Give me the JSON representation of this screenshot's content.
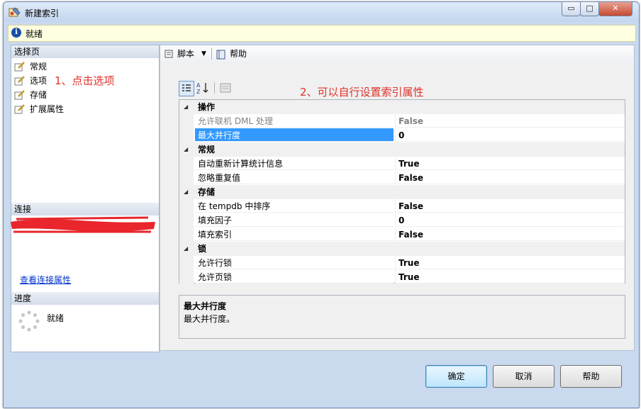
{
  "window": {
    "title": "新建索引",
    "controls": {
      "minimize": "▭",
      "maximize": "□",
      "close": "✕"
    }
  },
  "infobar": {
    "status": "就绪"
  },
  "left": {
    "select_page_header": "选择页",
    "pages": [
      {
        "label": "常规"
      },
      {
        "label": "选项"
      },
      {
        "label": "存储"
      },
      {
        "label": "扩展属性"
      }
    ],
    "connection_header": "连接",
    "view_connection_properties": "查看连接属性",
    "progress_header": "进度",
    "progress_status": "就绪"
  },
  "toolbar": {
    "script": "脚本",
    "help": "帮助"
  },
  "properties": {
    "categories": [
      {
        "name": "操作",
        "rows": [
          {
            "name": "允许联机 DML 处理",
            "value": "False"
          },
          {
            "name": "最大并行度",
            "value": "0"
          }
        ]
      },
      {
        "name": "常规",
        "rows": [
          {
            "name": "自动重新计算统计信息",
            "value": "True"
          },
          {
            "name": "忽略重复值",
            "value": "False"
          }
        ]
      },
      {
        "name": "存储",
        "rows": [
          {
            "name": "在 tempdb 中排序",
            "value": "False"
          },
          {
            "name": "填充因子",
            "value": "0"
          },
          {
            "name": "填充索引",
            "value": "False"
          }
        ]
      },
      {
        "name": "锁",
        "rows": [
          {
            "name": "允许行锁",
            "value": "True"
          },
          {
            "name": "允许页锁",
            "value": "True"
          }
        ]
      }
    ]
  },
  "description": {
    "title": "最大并行度",
    "text": "最大并行度。"
  },
  "buttons": {
    "ok": "确定",
    "cancel": "取消",
    "help": "帮助"
  },
  "annotations": {
    "step1": "1、点击选项",
    "step2": "2、可以自行设置索引属性"
  },
  "colors": {
    "annotation": "#e0312b",
    "selection": "#3399ff",
    "redaction": "#e8262b"
  }
}
